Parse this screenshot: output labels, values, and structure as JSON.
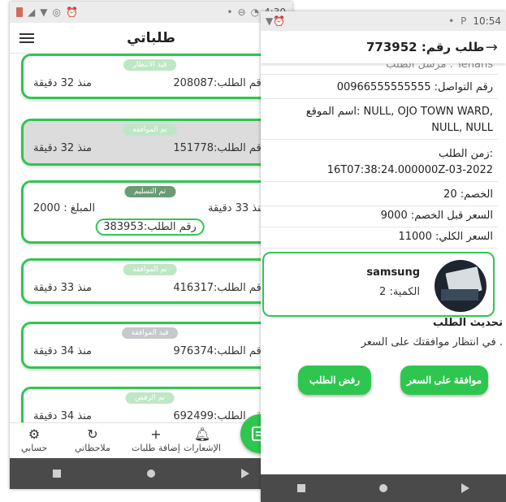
{
  "left_phone": {
    "status_time": "4:30",
    "title": "طلباتي",
    "orders": [
      {
        "status": "قيد الانتظار",
        "number_label": "رقم الطلب:208087",
        "time": "منذ 32 دقيقة"
      },
      {
        "status": "تم الموافقة",
        "number_label": "رقم الطلب:151778",
        "time": "منذ 32 دقيقة"
      },
      {
        "status": "تم التسليم",
        "time": "منذ 33 دقيقة",
        "amount": "المبلغ : 2000",
        "number_label": "رقم الطلب:383953"
      },
      {
        "status": "تم الموافقة",
        "number_label": "رقم الطلب:416317",
        "time": "منذ 33 دقيقة"
      },
      {
        "status": "قيد الموافقة",
        "number_label": "رقم الطلب:976374",
        "time": "منذ 34 دقيقة"
      },
      {
        "status": "تم الرفض",
        "number_label": "رقم الطلب:692499",
        "time": "منذ 34 دقيقة"
      }
    ],
    "nav": {
      "notifications": "الإشعارات",
      "add_orders": "إضافة طلبات",
      "my_notes": "ملاحظاتي",
      "my_account": "حسابي"
    }
  },
  "right_phone": {
    "status_time": "10:54",
    "title": "طلب رقم: 773952",
    "details": {
      "sender_cut": "مرسل الطلب : Tenahs",
      "contact": "رقم التواصل: 00966555555555",
      "location_line1": "اسم الموقع: NULL, OJO TOWN WARD,",
      "location_line2": "NULL, NULL",
      "time_label": "زمن الطلب:",
      "time_value": "16T07:38:24.000000Z-03-2022",
      "discount": "الخصم: 20",
      "price_before": "السعر قبل الخصم: 9000",
      "total": "السعر الكلي: 11000"
    },
    "product": {
      "name": "samsung",
      "qty": "الكمية: 2"
    },
    "update": {
      "title": "تحديث الطلب",
      "message": "في انتظار موافقتك على السعر .",
      "approve": "موافقة على السعر",
      "reject": "رفض الطلب"
    }
  },
  "colors": {
    "accent": "#2fc650",
    "system_nav": "#4a4a4a"
  }
}
